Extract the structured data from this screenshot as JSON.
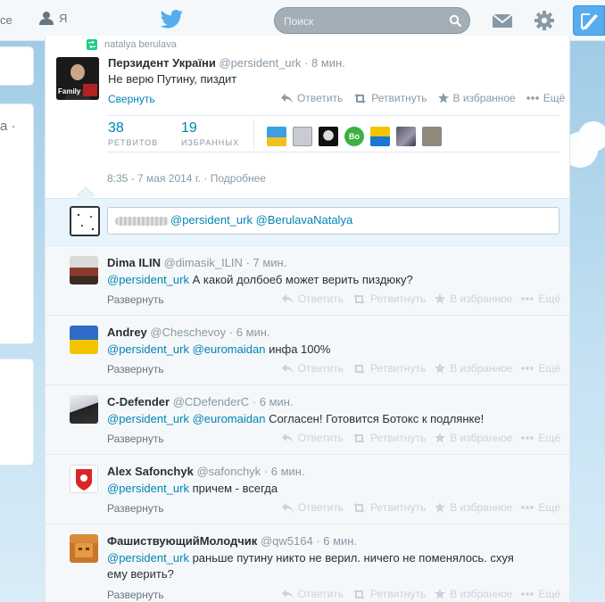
{
  "topbar": {
    "nav_fragment": "се",
    "me_label": "Я",
    "search_placeholder": "Поиск"
  },
  "left": {
    "card_text": "а ·"
  },
  "retweeted_by": "natalya berulava",
  "tweet": {
    "fullname": "Перзидент Украïни",
    "username": "@persident_urk",
    "time": "· 8 мин.",
    "text": "Не верю Путину, пиздит",
    "collapse": "Свернуть",
    "retweets_count": "38",
    "retweets_label": "РЕТВИТОВ",
    "favorites_count": "19",
    "favorites_label": "ИЗБРАННЫХ",
    "date": "8:35 - 7 мая 2014 г.",
    "details": "Подробнее",
    "avatar_caption": "Family",
    "bo_badge": "Bo"
  },
  "actions": {
    "reply": "Ответить",
    "retweet": "Ретвитнуть",
    "favorite": "В избранное",
    "more": "Ещё"
  },
  "reply_box": {
    "mention1": "@persident_urk",
    "mention2": "@BerulavaNatalya"
  },
  "replies": [
    {
      "fullname": "Dima ILIN",
      "username": "@dimasik_ILIN",
      "time": "· 7 мин.",
      "mention1": "@persident_urk",
      "mention2": "",
      "text": " А какой долбоеб  может верить пиздюку?",
      "text2": "",
      "expand": "Развернуть"
    },
    {
      "fullname": "Andrey",
      "username": "@Cheschevoy",
      "time": "· 6 мин.",
      "mention1": "@persident_urk",
      "mention2": "@euromaidan",
      "text": " инфа 100%",
      "text2": "",
      "expand": "Развернуть"
    },
    {
      "fullname": "C-Defender",
      "username": "@CDefenderC",
      "time": "· 6 мин.",
      "mention1": "@persident_urk",
      "mention2": "@euromaidan",
      "text": " Согласен! Готовится Ботокс к подлянке!",
      "text2": "",
      "expand": "Развернуть"
    },
    {
      "fullname": "Alex Safonchyk",
      "username": "@safonchyk",
      "time": "· 6 мин.",
      "mention1": "@persident_urk",
      "mention2": "",
      "text": " причем - всегда",
      "text2": "",
      "expand": "Развернуть"
    },
    {
      "fullname": "ФашиствующийМолодчик",
      "username": "@qw5164",
      "time": "· 6 мин.",
      "mention1": "@persident_urk",
      "mention2": "",
      "text": " раньше путину никто не верил. ничего не поменялось. схуя",
      "text2": "ему верить?",
      "expand": "Развернуть"
    }
  ],
  "colors": {
    "link": "#0084b4",
    "twitter_blue": "#55acee",
    "retweet_green": "#19cf86"
  }
}
